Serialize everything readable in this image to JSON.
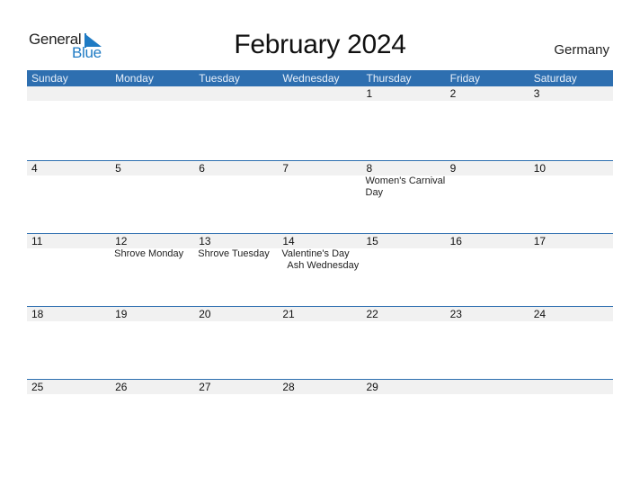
{
  "logo": {
    "general": "General",
    "blue": "Blue"
  },
  "title": "February 2024",
  "country": "Germany",
  "colors": {
    "header": "#2e6fb0",
    "brand_blue": "#1f7bc4",
    "strip": "#f1f1f1"
  },
  "weekdays": [
    "Sunday",
    "Monday",
    "Tuesday",
    "Wednesday",
    "Thursday",
    "Friday",
    "Saturday"
  ],
  "weeks": [
    {
      "days": [
        {
          "num": "",
          "events": []
        },
        {
          "num": "",
          "events": []
        },
        {
          "num": "",
          "events": []
        },
        {
          "num": "",
          "events": []
        },
        {
          "num": "1",
          "events": []
        },
        {
          "num": "2",
          "events": []
        },
        {
          "num": "3",
          "events": []
        }
      ]
    },
    {
      "days": [
        {
          "num": "4",
          "events": []
        },
        {
          "num": "5",
          "events": []
        },
        {
          "num": "6",
          "events": []
        },
        {
          "num": "7",
          "events": []
        },
        {
          "num": "8",
          "events": [
            "Women's Carnival",
            "Day"
          ]
        },
        {
          "num": "9",
          "events": []
        },
        {
          "num": "10",
          "events": []
        }
      ]
    },
    {
      "days": [
        {
          "num": "11",
          "events": []
        },
        {
          "num": "12",
          "events": [
            "Shrove Monday"
          ]
        },
        {
          "num": "13",
          "events": [
            "Shrove Tuesday"
          ]
        },
        {
          "num": "14",
          "events": [
            "Valentine's Day",
            "Ash Wednesday"
          ]
        },
        {
          "num": "15",
          "events": []
        },
        {
          "num": "16",
          "events": []
        },
        {
          "num": "17",
          "events": []
        }
      ]
    },
    {
      "days": [
        {
          "num": "18",
          "events": []
        },
        {
          "num": "19",
          "events": []
        },
        {
          "num": "20",
          "events": []
        },
        {
          "num": "21",
          "events": []
        },
        {
          "num": "22",
          "events": []
        },
        {
          "num": "23",
          "events": []
        },
        {
          "num": "24",
          "events": []
        }
      ]
    },
    {
      "days": [
        {
          "num": "25",
          "events": []
        },
        {
          "num": "26",
          "events": []
        },
        {
          "num": "27",
          "events": []
        },
        {
          "num": "28",
          "events": []
        },
        {
          "num": "29",
          "events": []
        },
        {
          "num": "",
          "events": []
        },
        {
          "num": "",
          "events": []
        }
      ]
    }
  ]
}
